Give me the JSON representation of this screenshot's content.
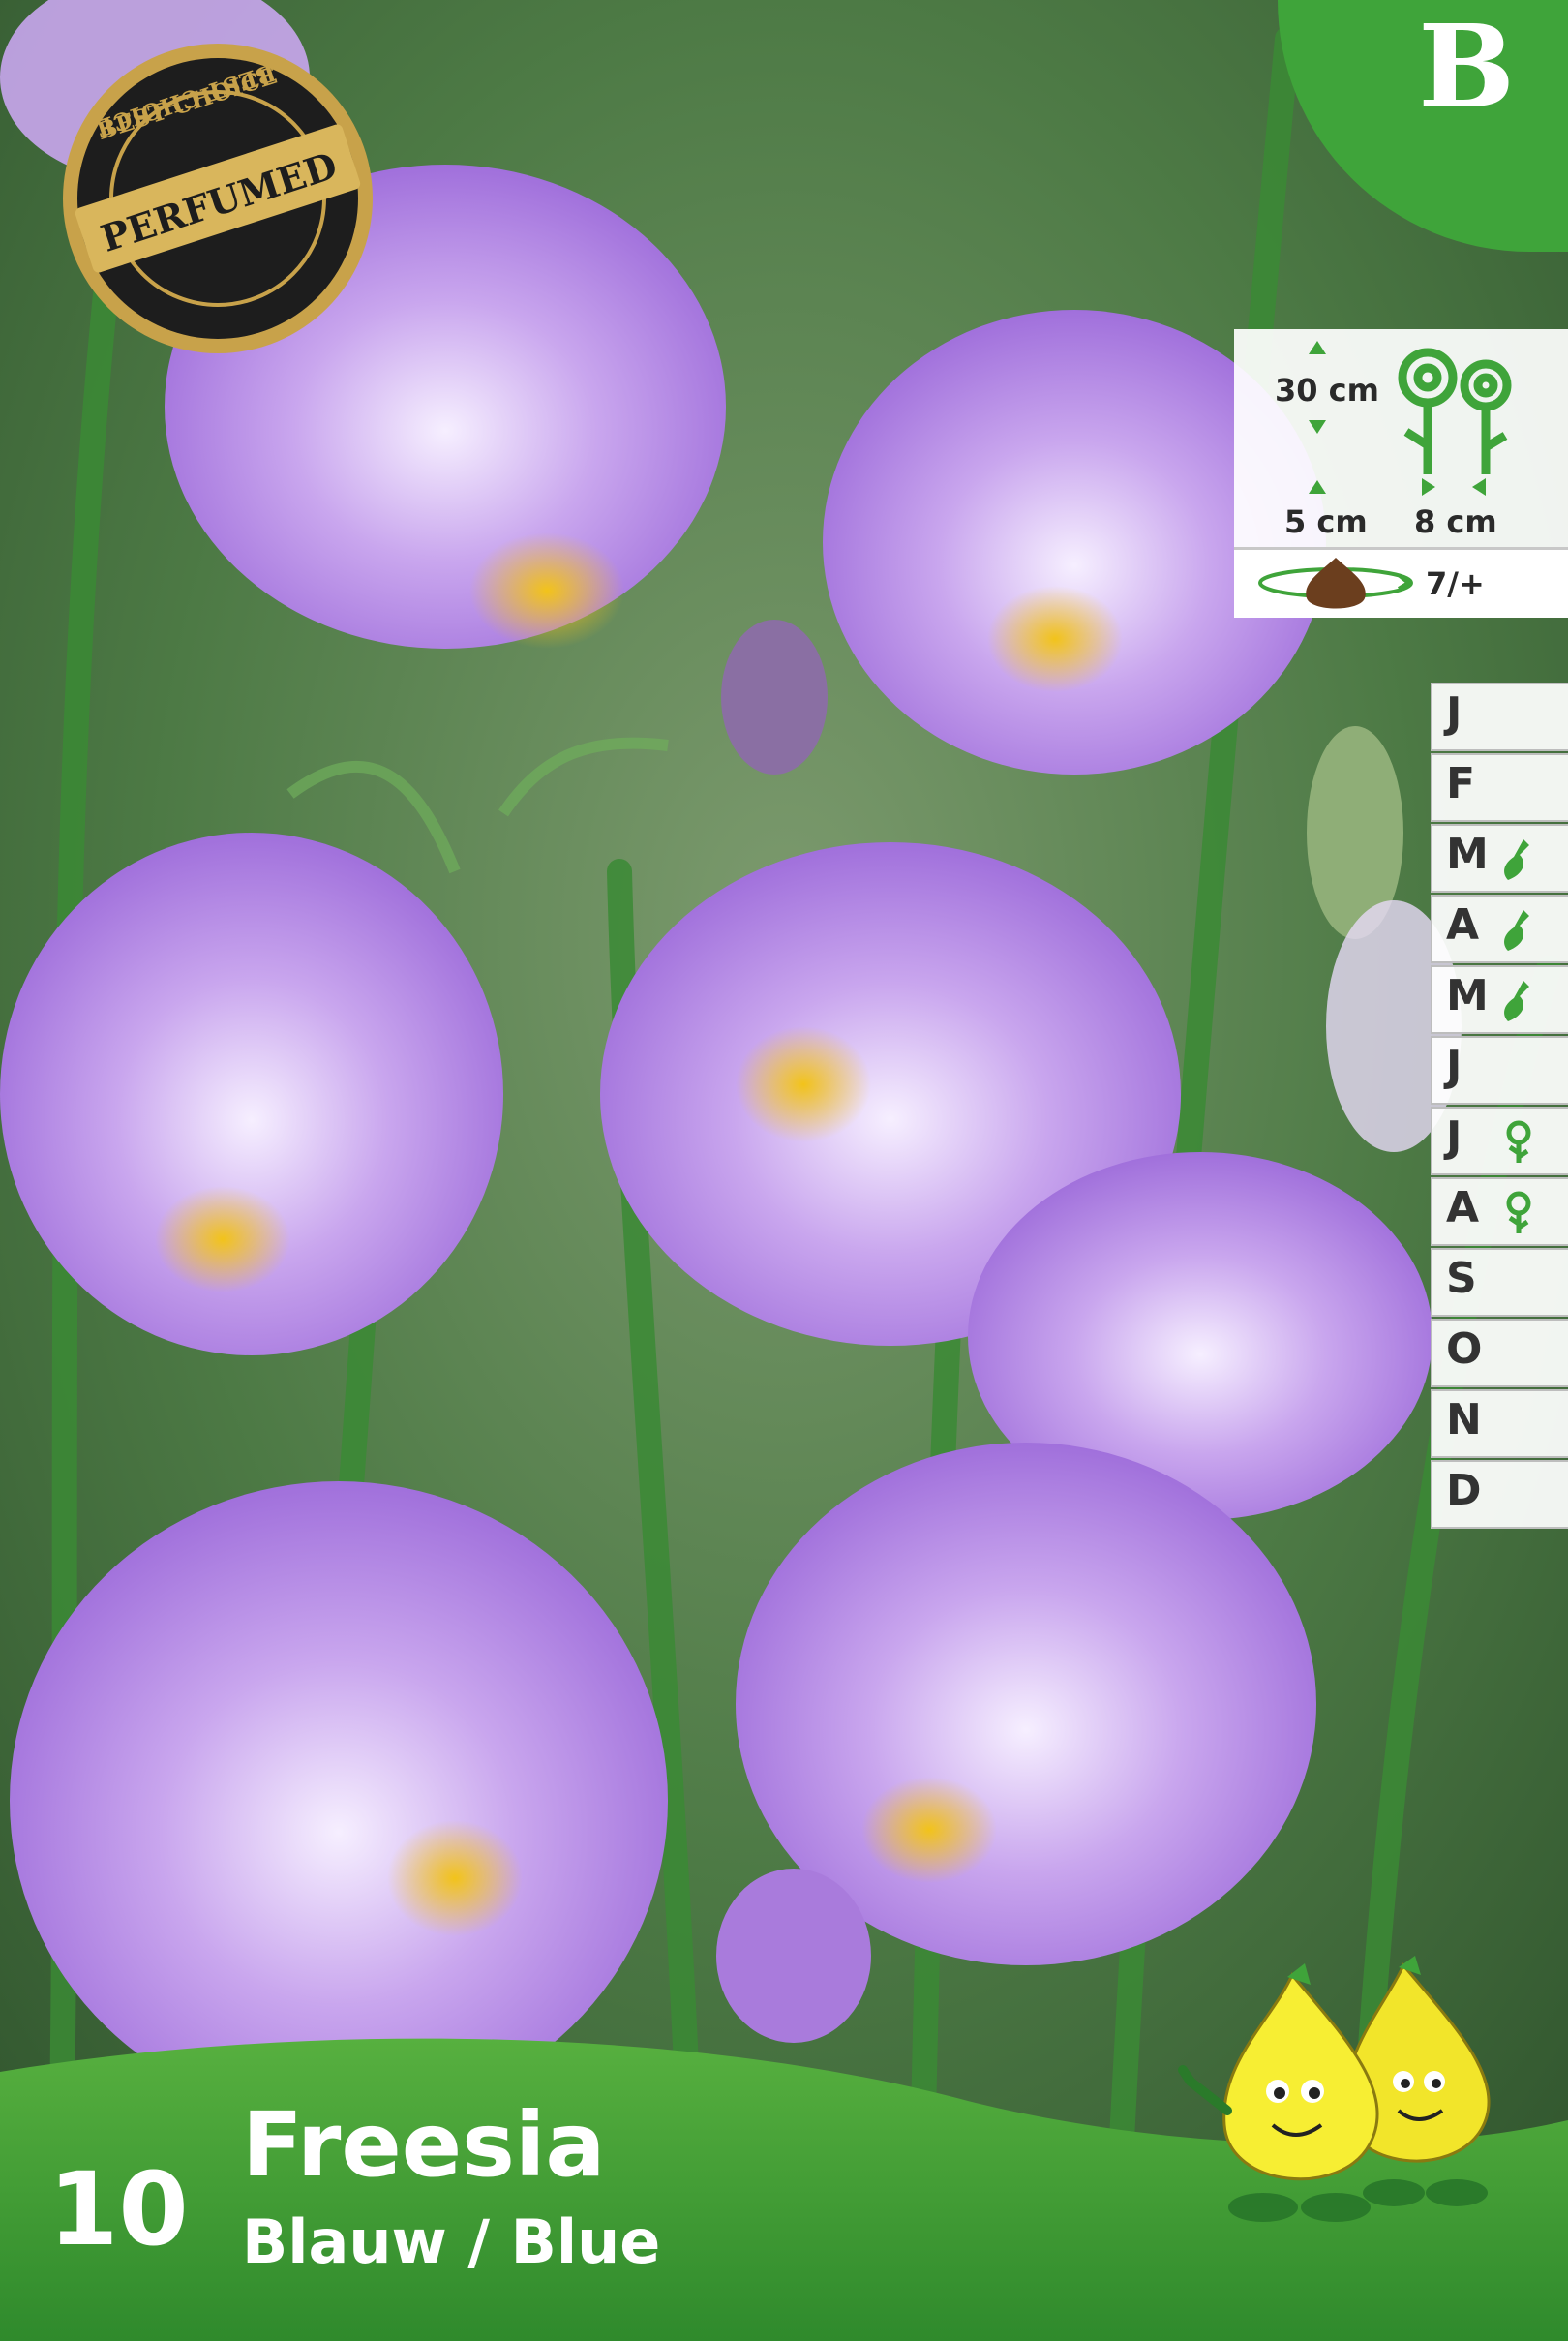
{
  "badge": {
    "letter": "B",
    "color": "#3fa43a"
  },
  "seal": {
    "top_text": "BEST CHOICE",
    "center_text": "PERFUMED",
    "bottom_text": "BEST CHOICE"
  },
  "info": {
    "height": "30 cm",
    "depth": "5 cm",
    "spacing": "8 cm",
    "bulb_size": "7/+"
  },
  "calendar": {
    "months": [
      {
        "letter": "J",
        "icon": ""
      },
      {
        "letter": "F",
        "icon": ""
      },
      {
        "letter": "M",
        "icon": "trowel-icon"
      },
      {
        "letter": "A",
        "icon": "trowel-icon"
      },
      {
        "letter": "M",
        "icon": "trowel-icon"
      },
      {
        "letter": "J",
        "icon": ""
      },
      {
        "letter": "J",
        "icon": "flower-icon"
      },
      {
        "letter": "A",
        "icon": "flower-icon"
      },
      {
        "letter": "S",
        "icon": ""
      },
      {
        "letter": "O",
        "icon": ""
      },
      {
        "letter": "N",
        "icon": ""
      },
      {
        "letter": "D",
        "icon": ""
      }
    ],
    "icon_color": "#3fa43a"
  },
  "product": {
    "count": "10",
    "name": "Freesia",
    "variety": "Blauw / Blue"
  }
}
